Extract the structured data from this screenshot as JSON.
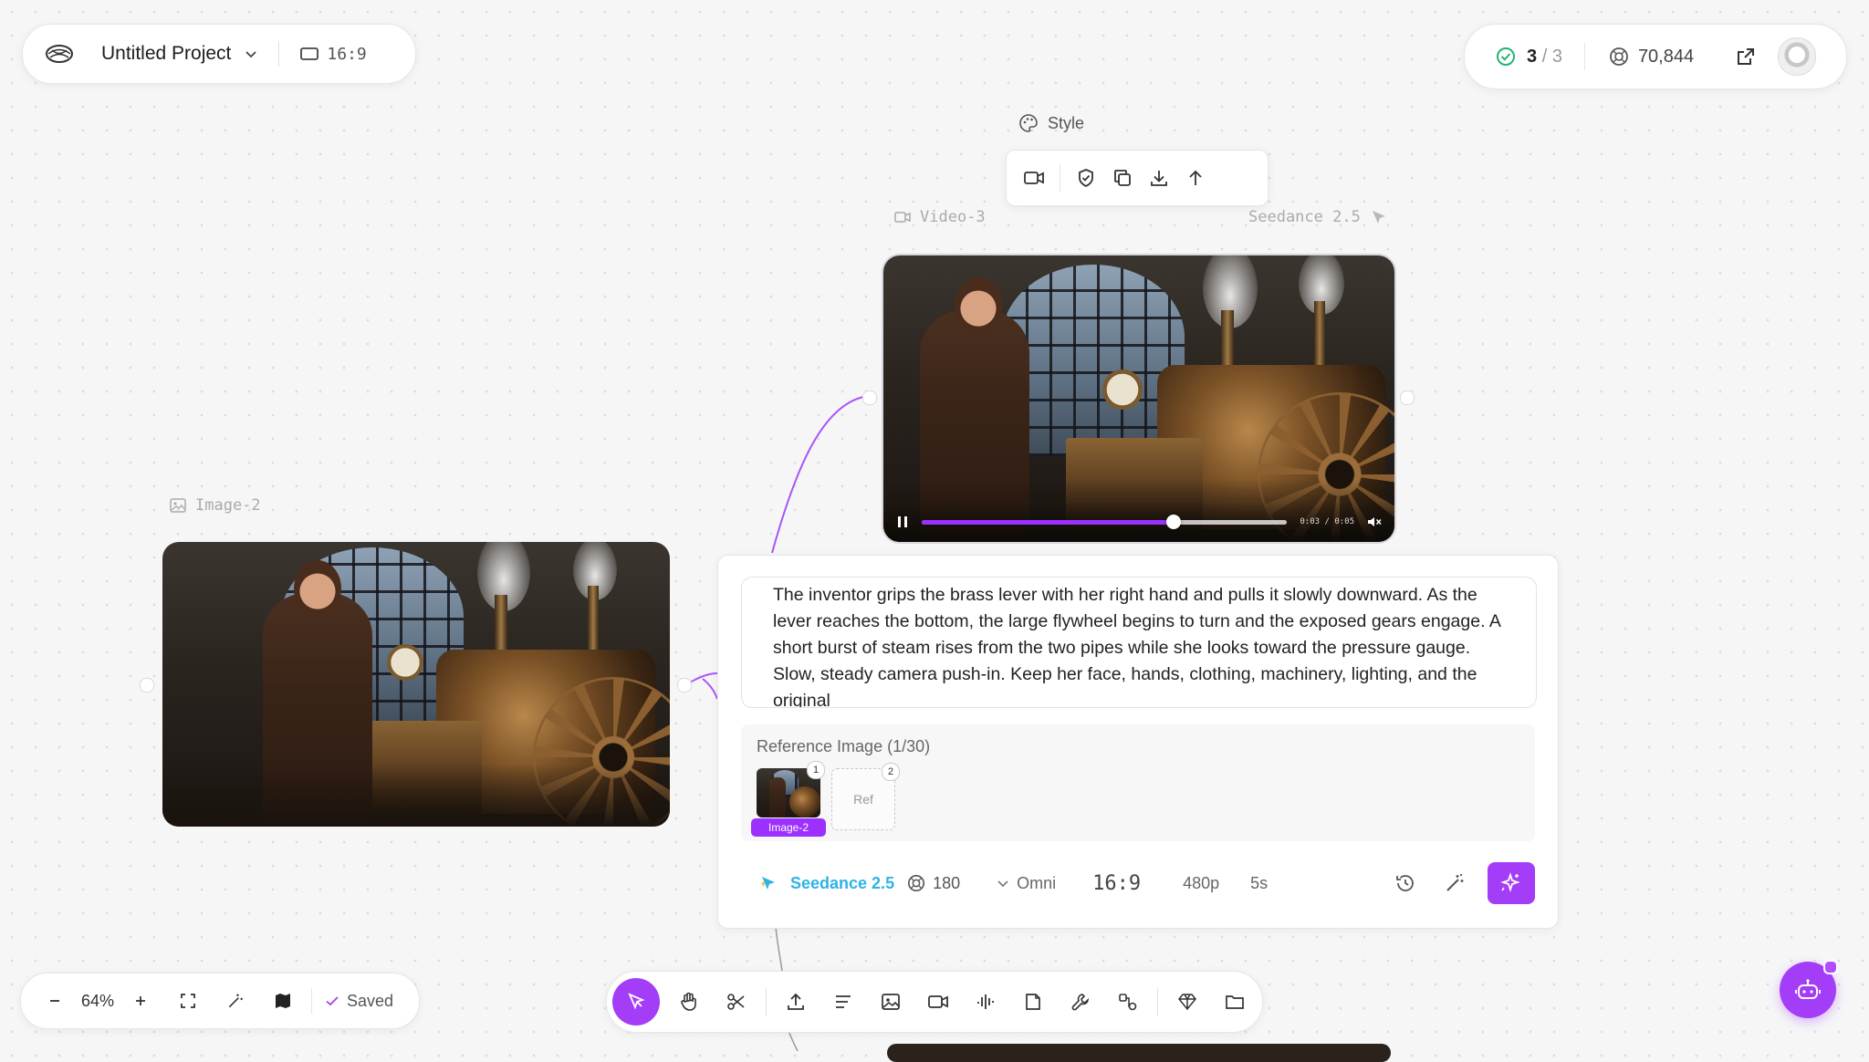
{
  "project": {
    "name": "Untitled Project",
    "aspect": "16:9"
  },
  "status": {
    "jobs_done": "3",
    "jobs_sep": "/",
    "jobs_total": "3",
    "credits": "70,844"
  },
  "style_label": "Style",
  "nodes": {
    "video": {
      "label": "Video-3",
      "model": "Seedance 2.5",
      "time": "0:03 / 0:05",
      "progress": 0.69
    },
    "image": {
      "label": "Image-2"
    }
  },
  "prompt": {
    "text": "The inventor grips the brass lever with her right hand and pulls it slowly downward. As the lever reaches the bottom, the large flywheel begins to turn and the exposed gears engage. A short burst of steam rises from the two pipes while she looks toward the pressure gauge. Slow, steady camera push-in. Keep her face, hands, clothing, machinery, lighting, and the original"
  },
  "reference": {
    "title": "Reference Image (1/30)",
    "items": [
      {
        "badge": "1",
        "tag": "Image-2"
      }
    ],
    "slot": {
      "badge": "2",
      "label": "Ref"
    }
  },
  "generation": {
    "model": "Seedance 2.5",
    "cost": "180",
    "mode": "Omni",
    "aspect": "16:9",
    "resolution": "480p",
    "duration": "5s"
  },
  "zoom": {
    "level": "64%",
    "saved": "Saved"
  },
  "colors": {
    "accent": "#a43df7",
    "model": "#2fb3e6",
    "progress": "#9b30ff"
  }
}
